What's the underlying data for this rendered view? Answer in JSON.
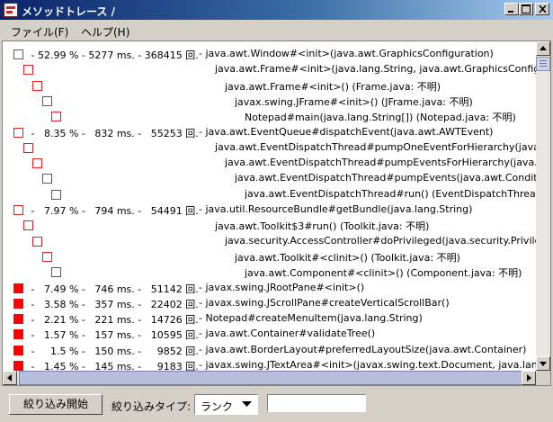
{
  "window": {
    "title": "メソッドトレース /"
  },
  "menu": {
    "file": "ファイル(F)",
    "help": "ヘルプ(H)"
  },
  "trace_rows": [
    {
      "filled": false,
      "indent": 0,
      "stats": " - 52.99 % - 5277 ms. - 368415 回.",
      "signature": "- java.awt.Window#<init>(java.awt.GraphicsConfiguration)"
    },
    {
      "filled": false,
      "indent": 1,
      "stats": "",
      "signature": "java.awt.Frame#<init>(java.lang.String, java.awt.GraphicsConfigu"
    },
    {
      "filled": false,
      "indent": 2,
      "stats": "",
      "signature": "java.awt.Frame#<init>()  (Frame.java: 不明)"
    },
    {
      "filled": false,
      "indent": 3,
      "stats": "",
      "signature": "javax.swing.JFrame#<init>()  (JFrame.java: 不明)"
    },
    {
      "filled": false,
      "indent": 4,
      "stats": "",
      "signature": "Notepad#main(java.lang.String[])  (Notepad.java: 不明)"
    },
    {
      "filled": false,
      "indent": 0,
      "stats": " -   8.35 % -   832 ms. -   55253 回.",
      "signature": "- java.awt.EventQueue#dispatchEvent(java.awt.AWTEvent)"
    },
    {
      "filled": false,
      "indent": 1,
      "stats": "",
      "signature": "java.awt.EventDispatchThread#pumpOneEventForHierarchy(java"
    },
    {
      "filled": false,
      "indent": 2,
      "stats": "",
      "signature": "java.awt.EventDispatchThread#pumpEventsForHierarchy(java.aw"
    },
    {
      "filled": false,
      "indent": 3,
      "stats": "",
      "signature": "java.awt.EventDispatchThread#pumpEvents(java.awt.Conditi"
    },
    {
      "filled": false,
      "indent": 4,
      "stats": "",
      "signature": "java.awt.EventDispatchThread#run()  (EventDispatchThread"
    },
    {
      "filled": false,
      "indent": 0,
      "stats": " -   7.97 % -   794 ms. -   54491 回.",
      "signature": "- java.util.ResourceBundle#getBundle(java.lang.String)"
    },
    {
      "filled": false,
      "indent": 1,
      "stats": "",
      "signature": "java.awt.Toolkit$3#run()  (Toolkit.java: 不明)"
    },
    {
      "filled": false,
      "indent": 2,
      "stats": "",
      "signature": "java.security.AccessController#doPrivileged(java.security.Privile"
    },
    {
      "filled": false,
      "indent": 3,
      "stats": "",
      "signature": "java.awt.Toolkit#<clinit>()  (Toolkit.java: 不明)"
    },
    {
      "filled": false,
      "indent": 4,
      "stats": "",
      "signature": "java.awt.Component#<clinit>()  (Component.java: 不明)"
    },
    {
      "filled": true,
      "indent": 0,
      "stats": " -   7.49 % -   746 ms. -   51142 回.",
      "signature": "- javax.swing.JRootPane#<init>()"
    },
    {
      "filled": true,
      "indent": 0,
      "stats": " -   3.58 % -   357 ms. -   22402 回.",
      "signature": "- javax.swing.JScrollPane#createVerticalScrollBar()"
    },
    {
      "filled": true,
      "indent": 0,
      "stats": " -   2.21 % -   221 ms. -   14726 回.",
      "signature": "- Notepad#createMenuItem(java.lang.String)"
    },
    {
      "filled": true,
      "indent": 0,
      "stats": " -   1.57 % -   157 ms. -   10595 回.",
      "signature": "- java.awt.Container#validateTree()"
    },
    {
      "filled": true,
      "indent": 0,
      "stats": " -     1.5 % -   150 ms. -     9852 回.",
      "signature": "- java.awt.BorderLayout#preferredLayoutSize(java.awt.Container)"
    },
    {
      "filled": true,
      "indent": 0,
      "stats": " -   1.45 % -   145 ms. -     9183 回.",
      "signature": "- javax.swing.JTextArea#<init>(javax.swing.text.Document, java.lang.S"
    }
  ],
  "toolbar": {
    "filter_button": "絞り込み開始",
    "filter_type_label": "絞り込みタイプ:",
    "filter_type_value": "ランク",
    "filter_text_value": ""
  }
}
